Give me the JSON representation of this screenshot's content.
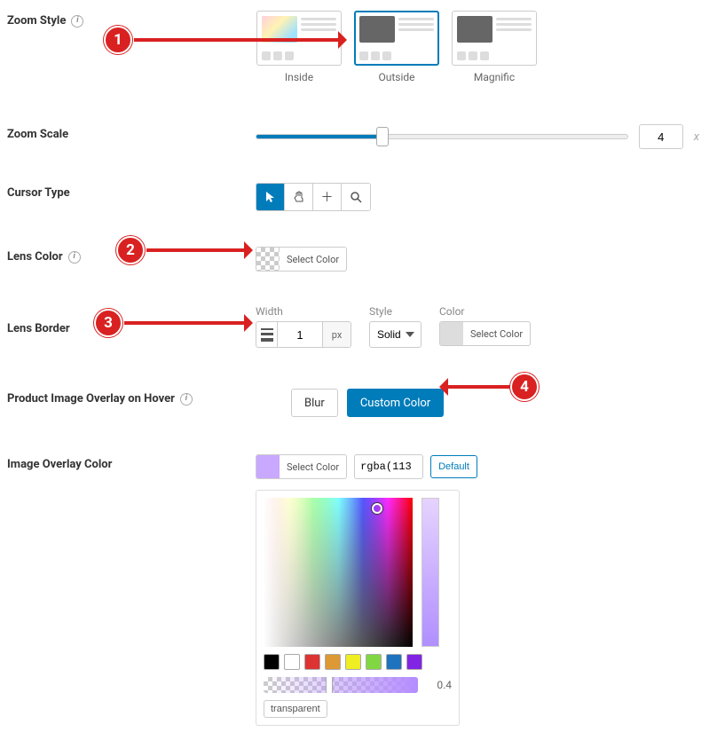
{
  "zoomStyle": {
    "label": "Zoom Style",
    "options": {
      "inside": "Inside",
      "outside": "Outside",
      "magnific": "Magnific"
    },
    "selected": "outside"
  },
  "zoomScale": {
    "label": "Zoom Scale",
    "value": "4",
    "unit": "x"
  },
  "cursorType": {
    "label": "Cursor Type"
  },
  "lensColor": {
    "label": "Lens Color",
    "button": "Select Color"
  },
  "lensBorder": {
    "label": "Lens Border",
    "widthLabel": "Width",
    "widthValue": "1",
    "widthUnit": "px",
    "styleLabel": "Style",
    "styleValue": "Solid",
    "colorLabel": "Color",
    "colorButton": "Select Color"
  },
  "overlayHover": {
    "label": "Product Image Overlay on Hover",
    "blur": "Blur",
    "custom": "Custom Color"
  },
  "overlayColor": {
    "label": "Image Overlay Color",
    "selectColor": "Select Color",
    "value": "rgba(113",
    "default": "Default",
    "alpha": "0.4",
    "transparent": "transparent",
    "swatch": "#c9a8ff"
  },
  "palette": [
    "#000000",
    "#ffffff",
    "#dd3333",
    "#dd9933",
    "#eeee22",
    "#81d742",
    "#1e73be",
    "#8224e3"
  ],
  "annotations": {
    "b1": "1",
    "b2": "2",
    "b3": "3",
    "b4": "4"
  }
}
